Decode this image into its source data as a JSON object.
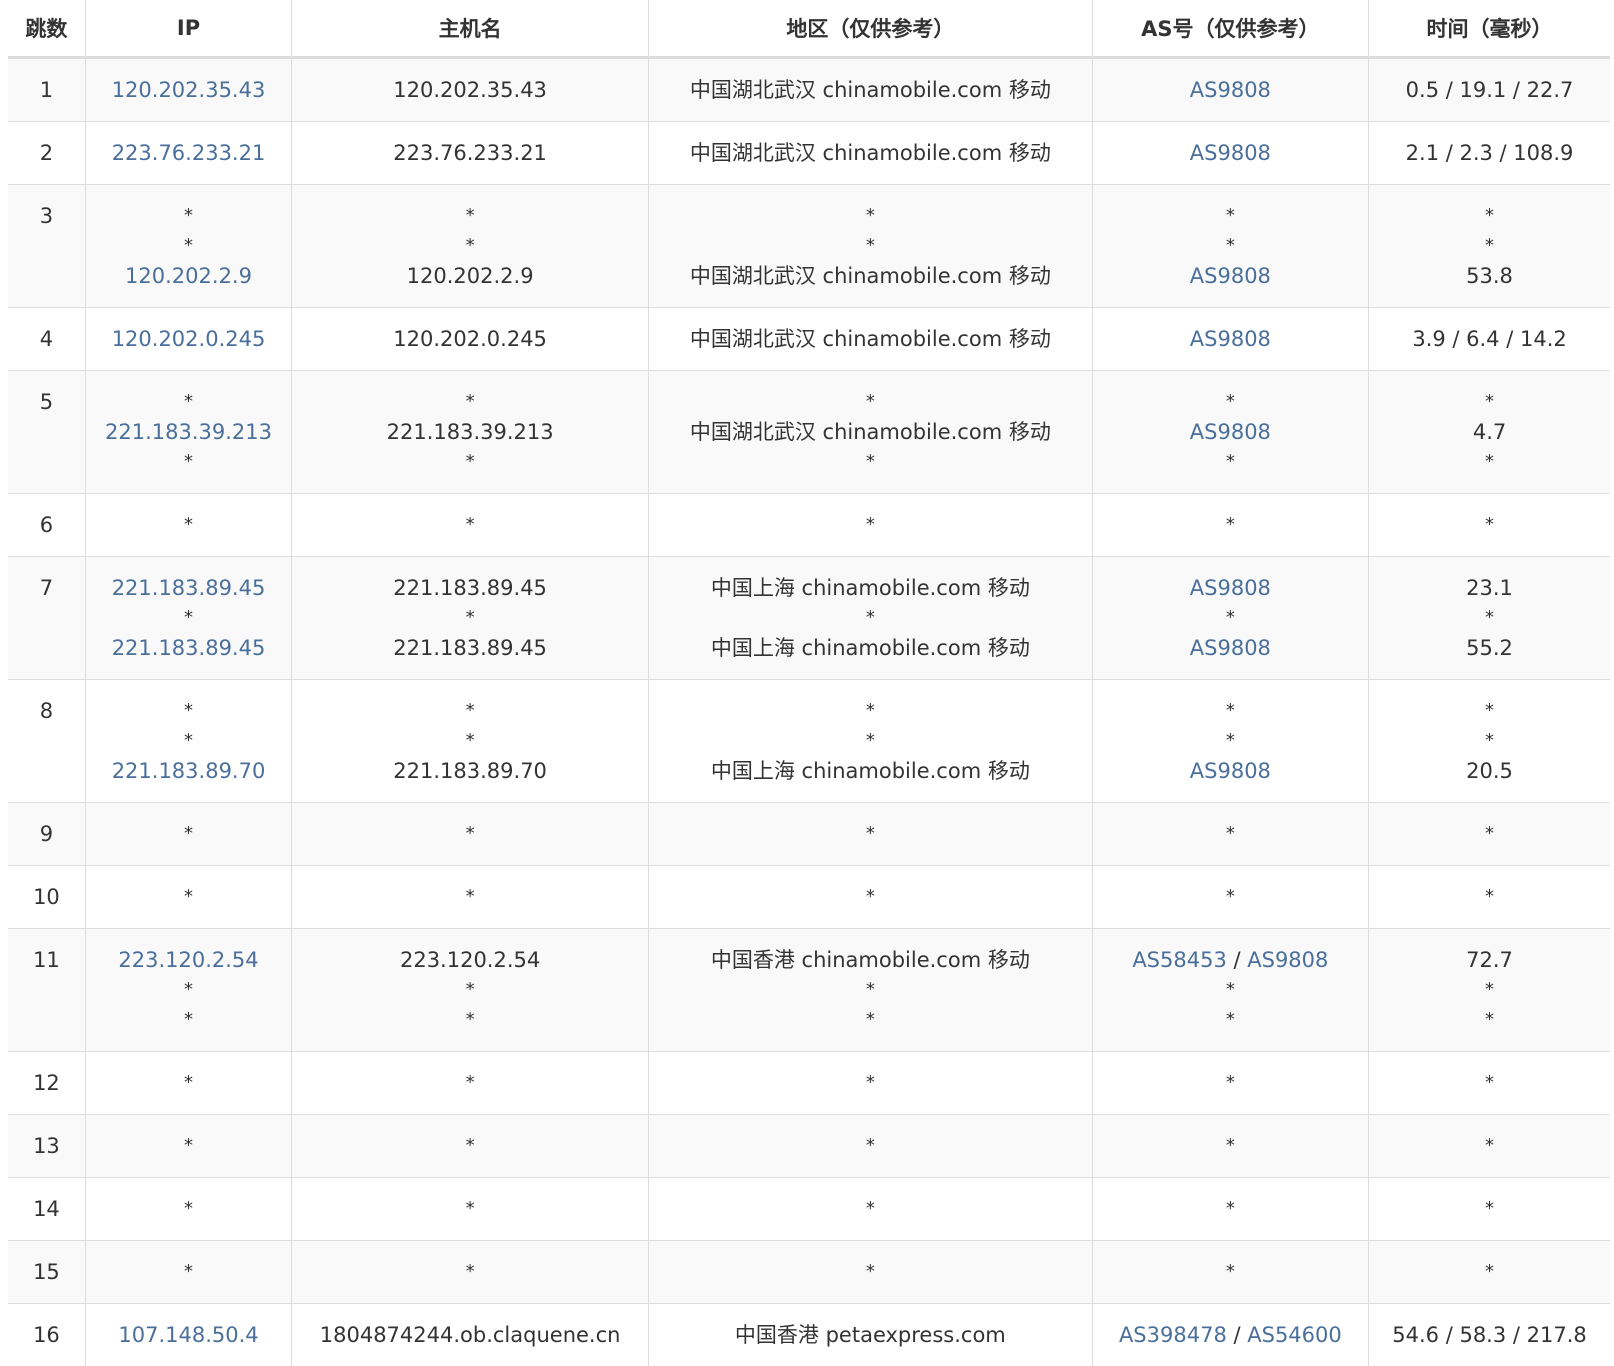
{
  "headers": [
    "跳数",
    "IP",
    "主机名",
    "地区（仅供参考）",
    "AS号（仅供参考）",
    "时间（毫秒）"
  ],
  "rows": [
    {
      "hop": "1",
      "ip": [
        "120.202.35.43"
      ],
      "host": [
        "120.202.35.43"
      ],
      "region": [
        "中国湖北武汉 chinamobile.com 移动"
      ],
      "as": [
        [
          "AS9808"
        ]
      ],
      "time": [
        "0.5 / 19.1 / 22.7"
      ]
    },
    {
      "hop": "2",
      "ip": [
        "223.76.233.21"
      ],
      "host": [
        "223.76.233.21"
      ],
      "region": [
        "中国湖北武汉 chinamobile.com 移动"
      ],
      "as": [
        [
          "AS9808"
        ]
      ],
      "time": [
        "2.1 / 2.3 / 108.9"
      ]
    },
    {
      "hop": "3",
      "ip": [
        "*",
        "*",
        "120.202.2.9"
      ],
      "host": [
        "*",
        "*",
        "120.202.2.9"
      ],
      "region": [
        "*",
        "*",
        "中国湖北武汉 chinamobile.com 移动"
      ],
      "as": [
        [
          "*"
        ],
        [
          "*"
        ],
        [
          "AS9808"
        ]
      ],
      "time": [
        "*",
        "*",
        "53.8"
      ]
    },
    {
      "hop": "4",
      "ip": [
        "120.202.0.245"
      ],
      "host": [
        "120.202.0.245"
      ],
      "region": [
        "中国湖北武汉 chinamobile.com 移动"
      ],
      "as": [
        [
          "AS9808"
        ]
      ],
      "time": [
        "3.9 / 6.4 / 14.2"
      ]
    },
    {
      "hop": "5",
      "ip": [
        "*",
        "221.183.39.213",
        "*"
      ],
      "host": [
        "*",
        "221.183.39.213",
        "*"
      ],
      "region": [
        "*",
        "中国湖北武汉 chinamobile.com 移动",
        "*"
      ],
      "as": [
        [
          "*"
        ],
        [
          "AS9808"
        ],
        [
          "*"
        ]
      ],
      "time": [
        "*",
        "4.7",
        "*"
      ]
    },
    {
      "hop": "6",
      "ip": [
        "*"
      ],
      "host": [
        "*"
      ],
      "region": [
        "*"
      ],
      "as": [
        [
          "*"
        ]
      ],
      "time": [
        "*"
      ]
    },
    {
      "hop": "7",
      "ip": [
        "221.183.89.45",
        "*",
        "221.183.89.45"
      ],
      "host": [
        "221.183.89.45",
        "*",
        "221.183.89.45"
      ],
      "region": [
        "中国上海 chinamobile.com 移动",
        "*",
        "中国上海 chinamobile.com 移动"
      ],
      "as": [
        [
          "AS9808"
        ],
        [
          "*"
        ],
        [
          "AS9808"
        ]
      ],
      "time": [
        "23.1",
        "*",
        "55.2"
      ]
    },
    {
      "hop": "8",
      "ip": [
        "*",
        "*",
        "221.183.89.70"
      ],
      "host": [
        "*",
        "*",
        "221.183.89.70"
      ],
      "region": [
        "*",
        "*",
        "中国上海 chinamobile.com 移动"
      ],
      "as": [
        [
          "*"
        ],
        [
          "*"
        ],
        [
          "AS9808"
        ]
      ],
      "time": [
        "*",
        "*",
        "20.5"
      ]
    },
    {
      "hop": "9",
      "ip": [
        "*"
      ],
      "host": [
        "*"
      ],
      "region": [
        "*"
      ],
      "as": [
        [
          "*"
        ]
      ],
      "time": [
        "*"
      ]
    },
    {
      "hop": "10",
      "ip": [
        "*"
      ],
      "host": [
        "*"
      ],
      "region": [
        "*"
      ],
      "as": [
        [
          "*"
        ]
      ],
      "time": [
        "*"
      ]
    },
    {
      "hop": "11",
      "ip": [
        "223.120.2.54",
        "*",
        "*"
      ],
      "host": [
        "223.120.2.54",
        "*",
        "*"
      ],
      "region": [
        "中国香港 chinamobile.com 移动",
        "*",
        "*"
      ],
      "as": [
        [
          "AS58453",
          "AS9808"
        ],
        [
          "*"
        ],
        [
          "*"
        ]
      ],
      "time": [
        "72.7",
        "*",
        "*"
      ]
    },
    {
      "hop": "12",
      "ip": [
        "*"
      ],
      "host": [
        "*"
      ],
      "region": [
        "*"
      ],
      "as": [
        [
          "*"
        ]
      ],
      "time": [
        "*"
      ]
    },
    {
      "hop": "13",
      "ip": [
        "*"
      ],
      "host": [
        "*"
      ],
      "region": [
        "*"
      ],
      "as": [
        [
          "*"
        ]
      ],
      "time": [
        "*"
      ]
    },
    {
      "hop": "14",
      "ip": [
        "*"
      ],
      "host": [
        "*"
      ],
      "region": [
        "*"
      ],
      "as": [
        [
          "*"
        ]
      ],
      "time": [
        "*"
      ]
    },
    {
      "hop": "15",
      "ip": [
        "*"
      ],
      "host": [
        "*"
      ],
      "region": [
        "*"
      ],
      "as": [
        [
          "*"
        ]
      ],
      "time": [
        "*"
      ]
    },
    {
      "hop": "16",
      "ip": [
        "107.148.50.4"
      ],
      "host": [
        "1804874244.ob.claquene.cn"
      ],
      "region": [
        "中国香港 petaexpress.com"
      ],
      "as": [
        [
          "AS398478",
          "AS54600"
        ]
      ],
      "time": [
        "54.6 / 58.3 / 217.8"
      ]
    }
  ],
  "colors": {
    "link": "#4a6f9a",
    "text": "#333333",
    "border": "#dddddd",
    "stripe": "#f9f9f9"
  }
}
